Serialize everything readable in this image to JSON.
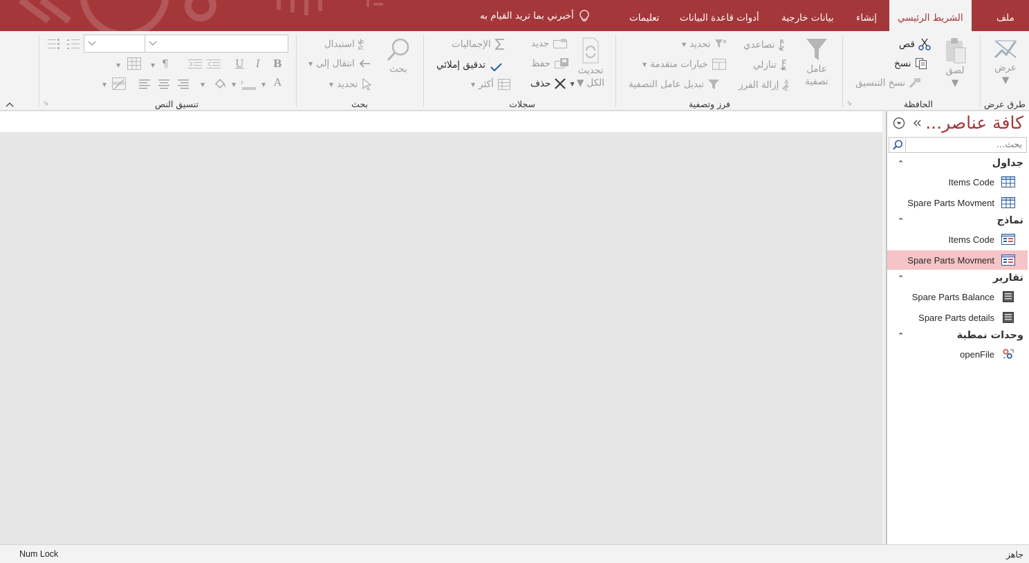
{
  "tabs": {
    "file": "ملف",
    "home": "الشريط الرئيسي",
    "create": "إنشاء",
    "external": "بيانات خارجية",
    "dbtools": "أدوات قاعدة البيانات",
    "help": "تعليمات",
    "tell_me": "أخبرني بما تريد القيام به"
  },
  "ribbon": {
    "views": {
      "view": "عرض",
      "group": "طرق عرض"
    },
    "clipboard": {
      "paste": "لصق",
      "cut": "قص",
      "copy": "نسخ",
      "format_painter": "نسخ التنسيق",
      "group": "الحافظة"
    },
    "sort_filter": {
      "filter_line1": "عامل",
      "filter_line2": "تصفية",
      "ascending": "تصاعدي",
      "descending": "تنازلي",
      "remove_sort": "إزالة الفرز",
      "selection": "تحديد",
      "advanced": "خيارات متقدمة",
      "toggle_filter": "تبديل عامل التصفية",
      "group": "فرز وتصفية"
    },
    "records": {
      "refresh_line1": "تحديث",
      "refresh_line2": "الكل",
      "new": "جديد",
      "save": "حفظ",
      "delete": "حذف",
      "totals": "الإجماليات",
      "spelling": "تدقيق إملائي",
      "more": "أكثر",
      "group": "سجلات"
    },
    "find": {
      "find": "بحث",
      "replace": "استبدال",
      "goto": "انتقال إلى",
      "select": "تحديد",
      "group": "بحث"
    },
    "text_formatting": {
      "group": "تنسيق النص",
      "font_name": "",
      "font_size": ""
    }
  },
  "nav": {
    "title": "كافة عناصر...",
    "search_placeholder": "بحث...",
    "categories": [
      {
        "label": "جداول",
        "items": [
          {
            "label": "Items Code",
            "icon": "table-icon"
          },
          {
            "label": "Spare Parts Movment",
            "icon": "table-icon"
          }
        ]
      },
      {
        "label": "نماذج",
        "items": [
          {
            "label": "Items Code",
            "icon": "form-icon"
          },
          {
            "label": "Spare Parts Movment",
            "icon": "form-icon",
            "selected": true
          }
        ]
      },
      {
        "label": "تقارير",
        "items": [
          {
            "label": "Spare Parts Balance",
            "icon": "report-icon"
          },
          {
            "label": "Spare Parts details",
            "icon": "report-icon"
          }
        ]
      },
      {
        "label": "وحدات نمطية",
        "items": [
          {
            "label": "openFile",
            "icon": "module-icon"
          }
        ]
      }
    ]
  },
  "status": {
    "ready": "جاهز",
    "num_lock": "Num Lock"
  },
  "colors": {
    "accent": "#a4373a",
    "selected": "#f6c4c6"
  }
}
